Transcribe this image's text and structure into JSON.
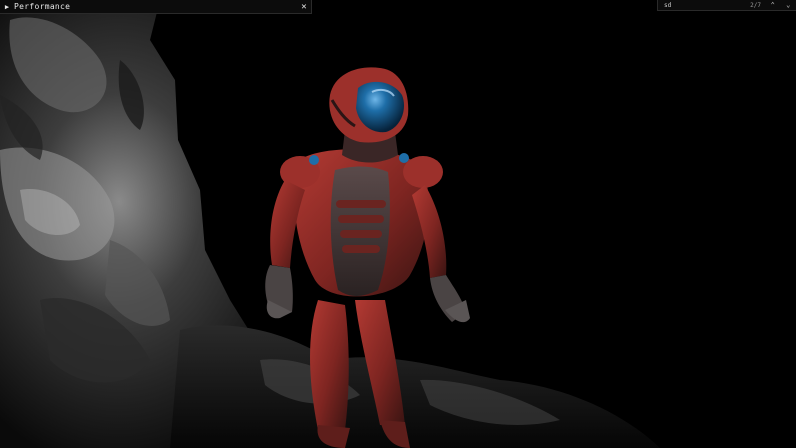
{
  "perf_window": {
    "title": "Performance",
    "expand_icon": "triangle-right-icon",
    "close_icon": "close-icon",
    "close_glyph": "✕"
  },
  "find_widget": {
    "query": "sd",
    "match_count": "2/7",
    "prev_icon": "chevron-up-icon",
    "next_icon": "chevron-down-icon"
  },
  "colors": {
    "background": "#000000",
    "armor_red": "#8e2a26",
    "armor_dark": "#3a2a2a",
    "visor_blue": "#1e6ea8",
    "rock": "#3c3c3c"
  }
}
